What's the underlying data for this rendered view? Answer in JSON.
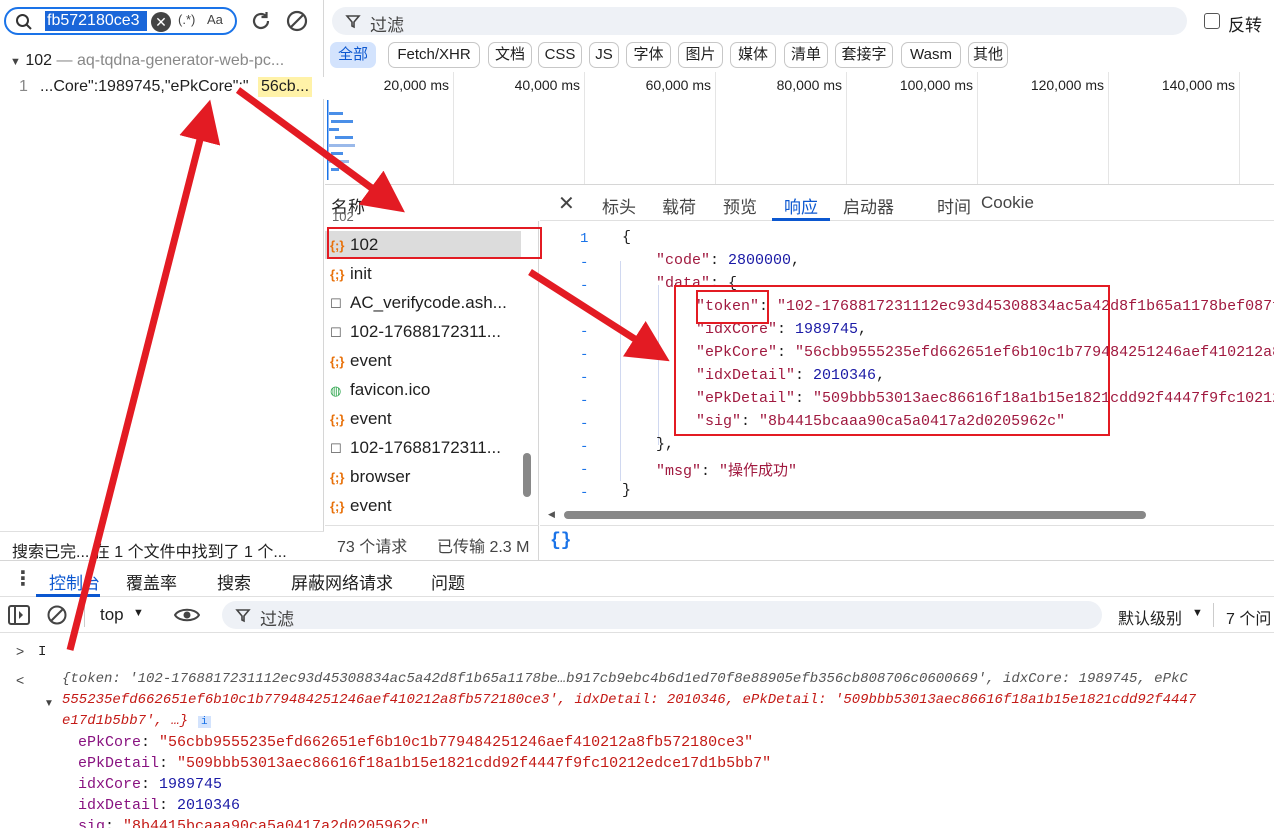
{
  "search": {
    "query": "fb572180ce3",
    "regex_btn": "(.*)",
    "case_btn": "Aa",
    "result_file": "102",
    "result_file_url": "aq-tqdna-generator-web-pc...",
    "result_line_no": "1",
    "result_text_pre": "...Core\":1989745,\"ePkCore\":\"",
    "result_text_hl": "56cb...",
    "status": "搜索已完... 在 1 个文件中找到了 1 个..."
  },
  "filter": {
    "placeholder": "过滤",
    "invert_label": "反转"
  },
  "chips": [
    "全部",
    "Fetch/XHR",
    "文档",
    "CSS",
    "JS",
    "字体",
    "图片",
    "媒体",
    "清单",
    "套接字",
    "Wasm",
    "其他"
  ],
  "ticks": [
    "20,000 ms",
    "40,000 ms",
    "60,000 ms",
    "80,000 ms",
    "100,000 ms",
    "120,000 ms",
    "140,000 ms"
  ],
  "list": {
    "header": "名称",
    "top_partial": "102",
    "items": [
      {
        "icon": "{;}",
        "name": "102"
      },
      {
        "icon": "{;}",
        "name": "init"
      },
      {
        "icon": "☐",
        "name": "AC_verifycode.ash..."
      },
      {
        "icon": "☐",
        "name": "102-17688172311..."
      },
      {
        "icon": "{;}",
        "name": "event"
      },
      {
        "icon": "◍",
        "name": "favicon.ico"
      },
      {
        "icon": "{;}",
        "name": "event"
      },
      {
        "icon": "☐",
        "name": "102-17688172311..."
      },
      {
        "icon": "{;}",
        "name": "browser"
      },
      {
        "icon": "{;}",
        "name": "event"
      }
    ],
    "footer_requests": "73 个请求",
    "footer_transferred": "已传输 2.3 M"
  },
  "detail_tabs": [
    "标头",
    "载荷",
    "预览",
    "响应",
    "启动器",
    "时间",
    "Cookie"
  ],
  "response": {
    "line1": "{",
    "code_key": "\"code\"",
    "code_val": "2800000",
    "data_key": "\"data\"",
    "token_key": "\"token\"",
    "token_val": "\"102-1768817231112ec93d45308834ac5a42d8f1b65a1178bef087f",
    "idxCore_key": "\"idxCore\"",
    "idxCore_val": "1989745",
    "ePkCore_key": "\"ePkCore\"",
    "ePkCore_val": "\"56cbb9555235efd662651ef6b10c1b779484251246aef410212a8",
    "idxDetail_key": "\"idxDetail\"",
    "idxDetail_val": "2010346",
    "ePkDetail_key": "\"ePkDetail\"",
    "ePkDetail_val": "\"509bbb53013aec86616f18a1b15e1821cdd92f4447f9fc10212",
    "sig_key": "\"sig\"",
    "sig_val": "\"8b4415bcaaa90ca5a0417a2d0205962c\"",
    "close_data": "},",
    "msg_key": "\"msg\"",
    "msg_val": "\"操作成功\"",
    "close": "}",
    "format_btn": "{}"
  },
  "drawer": {
    "tabs": [
      "控制台",
      "覆盖率",
      "搜索",
      "屏蔽网络请求",
      "问题"
    ],
    "context": "top",
    "filter_placeholder": "过滤",
    "level": "默认级别",
    "issues": "7 个问",
    "prompt": "I",
    "obj_line1": "{token: '102-1768817231112ec93d45308834ac5a42d8f1b65a1178be…b917cb9ebc4b6d1ed70f8e88905efb356cb808706c0600669', idxCore: 1989745, ePkC",
    "obj_line2": "555235efd662651ef6b10c1b779484251246aef410212a8fb572180ce3', idxDetail: 2010346, ePkDetail: '509bbb53013aec86616f18a1b15e1821cdd92f4447",
    "obj_line3": "e17d1b5bb7',  …}",
    "props": [
      {
        "key": "ePkCore",
        "val": "\"56cbb9555235efd662651ef6b10c1b779484251246aef410212a8fb572180ce3\""
      },
      {
        "key": "ePkDetail",
        "val": "\"509bbb53013aec86616f18a1b15e1821cdd92f4447f9fc10212edce17d1b5bb7\""
      },
      {
        "key": "idxCore",
        "val": "1989745"
      },
      {
        "key": "idxDetail",
        "val": "2010346"
      },
      {
        "key": "sig",
        "val": "\"8b4415bcaaa90ca5a0417a2d0205962c\""
      }
    ]
  },
  "colors": {
    "accent": "#1a73e8",
    "annotation_red": "#e31b23"
  }
}
